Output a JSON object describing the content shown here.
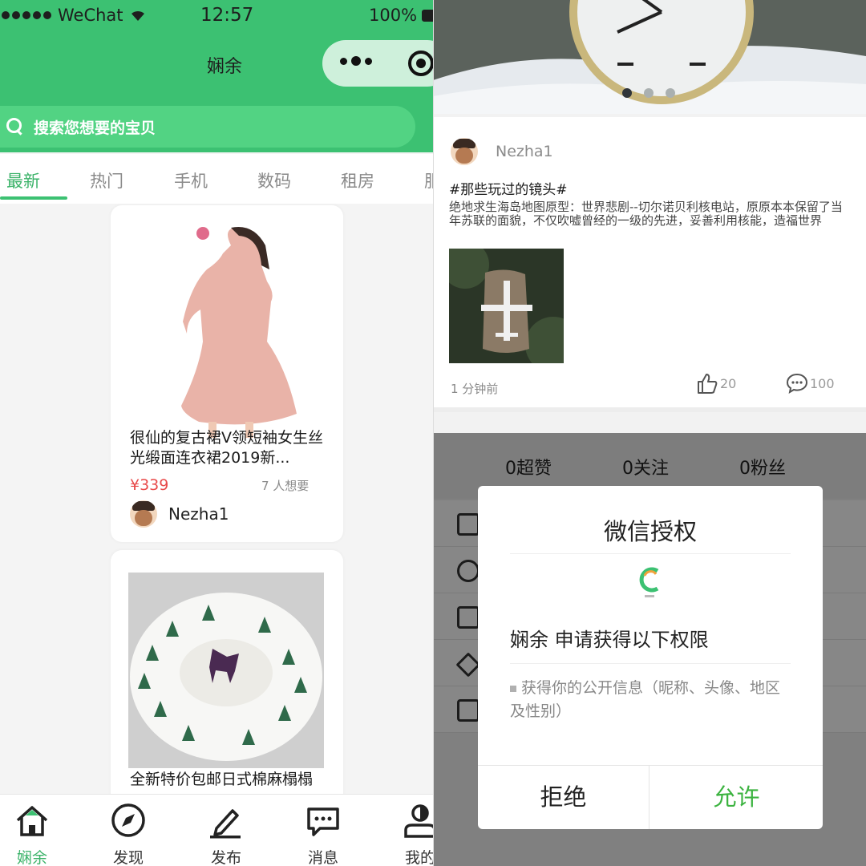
{
  "status_bar": {
    "carrier": "WeChat",
    "time": "12:57",
    "battery": "100%"
  },
  "app": {
    "title": "娴余"
  },
  "search": {
    "placeholder": "搜索您想要的宝贝"
  },
  "tabs": [
    "最新",
    "热门",
    "手机",
    "数码",
    "租房",
    "服"
  ],
  "products": [
    {
      "title": "很仙的复古裙V领短袖女生丝光缎面连衣裙2019新...",
      "price": "¥339",
      "wants": "7 人想要",
      "user": "Nezha1"
    },
    {
      "title": "全新特价包邮日式棉麻榻榻"
    }
  ],
  "tabbar": [
    {
      "label": "娴余",
      "icon": "home-icon"
    },
    {
      "label": "发现",
      "icon": "compass-icon"
    },
    {
      "label": "发布",
      "icon": "edit-icon"
    },
    {
      "label": "消息",
      "icon": "message-icon"
    },
    {
      "label": "我的",
      "icon": "user-icon"
    }
  ],
  "post": {
    "user": "Nezha1",
    "tag": "#那些玩过的镜头#",
    "body": "绝地求生海岛地图原型：世界悲剧--切尔诺贝利核电站，原原本本保留了当年苏联的面貌，不仅吹嘘曾经的一级的先进，妥善利用核能，造福世界",
    "time": "1 分钟前",
    "likes": "20",
    "comments": "100"
  },
  "profile_stats": {
    "super_likes": "0超赞",
    "following": "0关注",
    "fans": "0粉丝"
  },
  "auth_dialog": {
    "title": "微信授权",
    "request": "娴余 申请获得以下权限",
    "permission": "获得你的公开信息（昵称、头像、地区及性别）",
    "deny": "拒绝",
    "allow": "允许"
  },
  "colors": {
    "brand_green": "#3cc172",
    "price_red": "#e84a4a",
    "allow_green": "#3cb340"
  }
}
